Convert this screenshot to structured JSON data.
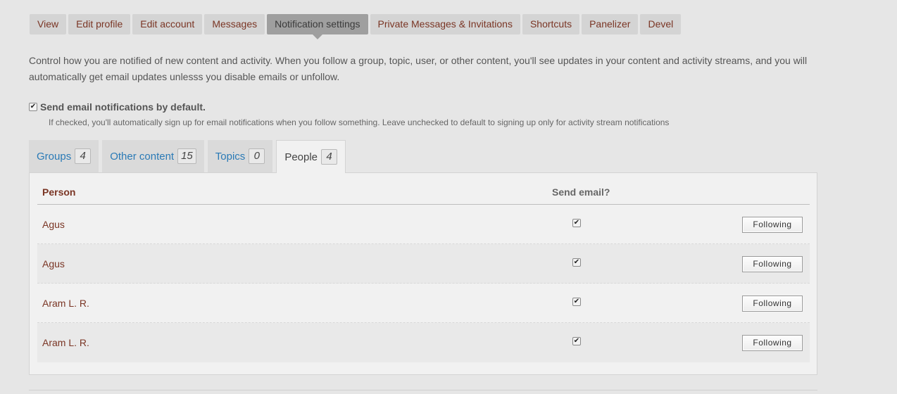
{
  "primary_tabs": [
    {
      "label": "View"
    },
    {
      "label": "Edit profile"
    },
    {
      "label": "Edit account"
    },
    {
      "label": "Messages"
    },
    {
      "label": "Notification settings",
      "active": true
    },
    {
      "label": "Private Messages & Invitations"
    },
    {
      "label": "Shortcuts"
    },
    {
      "label": "Panelizer"
    },
    {
      "label": "Devel"
    }
  ],
  "intro": {
    "text": "Control how you are notified of new content and activity. When you follow a group, topic, user, or other content, you'll see updates in your content and activity streams, and you will automatically get email updates unlesss you disable emails or unfollow."
  },
  "default_email": {
    "label": "Send email notifications by default.",
    "checked": true,
    "description": "If checked, you'll automatically sign up for email notifications when you follow something. Leave unchecked to default to signing up only for activity stream notifications"
  },
  "sub_tabs": [
    {
      "label": "Groups",
      "count": "4"
    },
    {
      "label": "Other content",
      "count": "15"
    },
    {
      "label": "Topics",
      "count": "0"
    },
    {
      "label": "People",
      "count": "4",
      "active": true
    }
  ],
  "table": {
    "headers": {
      "person": "Person",
      "send_email": "Send email?"
    },
    "rows": [
      {
        "person": "Agus",
        "send_email": true,
        "button": "Following"
      },
      {
        "person": "Agus",
        "send_email": true,
        "button": "Following"
      },
      {
        "person": "Aram L. R.",
        "send_email": true,
        "button": "Following"
      },
      {
        "person": "Aram L. R.",
        "send_email": true,
        "button": "Following"
      }
    ]
  },
  "colors": {
    "background": "#e6e6e6",
    "link_brown": "#7a3524",
    "link_blue": "#2a7ab6",
    "active_tab": "#9f9f9f"
  },
  "icons": {
    "checkbox_checked": "check-icon"
  }
}
